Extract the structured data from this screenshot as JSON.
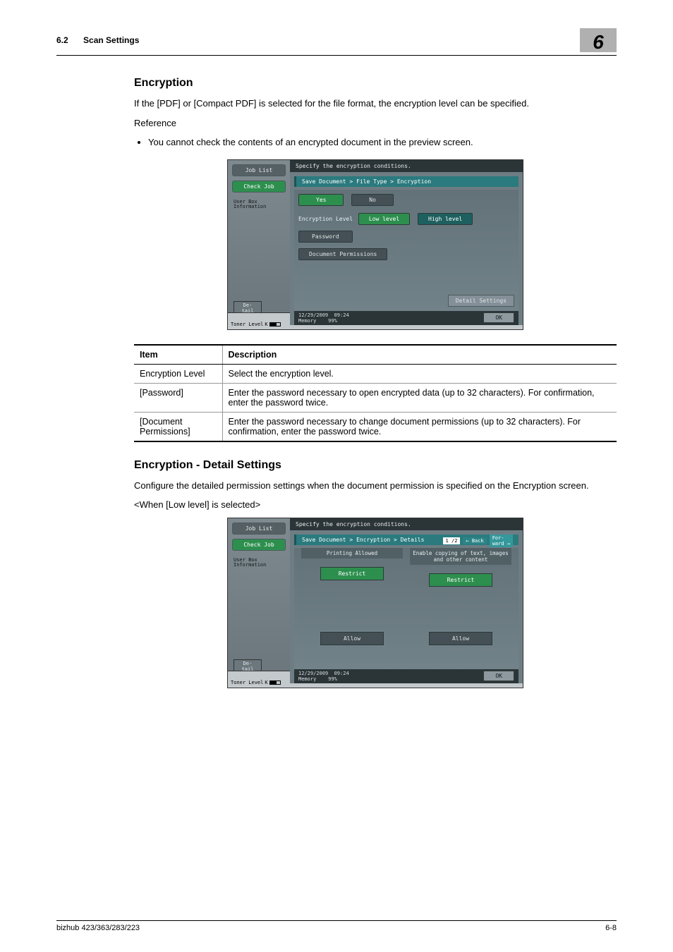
{
  "header": {
    "section_number": "6.2",
    "section_title": "Scan Settings",
    "chapter_number": "6"
  },
  "encryption": {
    "heading": "Encryption",
    "intro": "If the [PDF] or [Compact PDF] is selected for the file format, the encryption level can be specified.",
    "reference_label": "Reference",
    "bullet1": "You cannot check the contents of an encrypted document in the preview screen."
  },
  "panel1": {
    "instruction": "Specify the encryption conditions.",
    "job_list": "Job List",
    "check_job": "Check Job",
    "user_box": "User Box\nInformation",
    "detail_tab": "De-\ntail",
    "toner_label": "Toner Level",
    "toner_k": "K",
    "breadcrumb": "Save Document > File Type > Encryption",
    "yes": "Yes",
    "no": "No",
    "enc_level_label": "Encryption Level",
    "low_level": "Low level",
    "high_level": "High level",
    "password": "Password",
    "doc_perm": "Document Permissions",
    "detail_settings": "Detail Settings",
    "date": "12/29/2009",
    "time": "09:24",
    "memory": "Memory",
    "mem_val": "99%",
    "ok": "OK"
  },
  "table1": {
    "h_item": "Item",
    "h_desc": "Description",
    "rows": [
      {
        "item": "Encryption Level",
        "desc": "Select the encryption level."
      },
      {
        "item": "[Password]",
        "desc": "Enter the password necessary to open encrypted data (up to 32 characters). For confirmation, enter the password twice."
      },
      {
        "item": "[Document Permissions]",
        "desc": "Enter the password necessary to change document permissions (up to 32 characters). For confirmation, enter the password twice."
      }
    ]
  },
  "detail": {
    "heading": "Encryption - Detail Settings",
    "body": "Configure the detailed permission settings when the document permission is specified on the Encryption screen.",
    "when_low": "<When [Low level] is selected>"
  },
  "panel2": {
    "instruction": "Specify the encryption conditions.",
    "breadcrumb": "Save Document > Encryption > Details",
    "page": "1 /2",
    "back": "Back",
    "forward": "For-\nward",
    "col1_head": "Printing Allowed",
    "col2_head": "Enable copying of text, images\nand other content",
    "restrict": "Restrict",
    "allow": "Allow",
    "ok": "OK"
  },
  "footer": {
    "model": "bizhub 423/363/283/223",
    "page": "6-8"
  }
}
